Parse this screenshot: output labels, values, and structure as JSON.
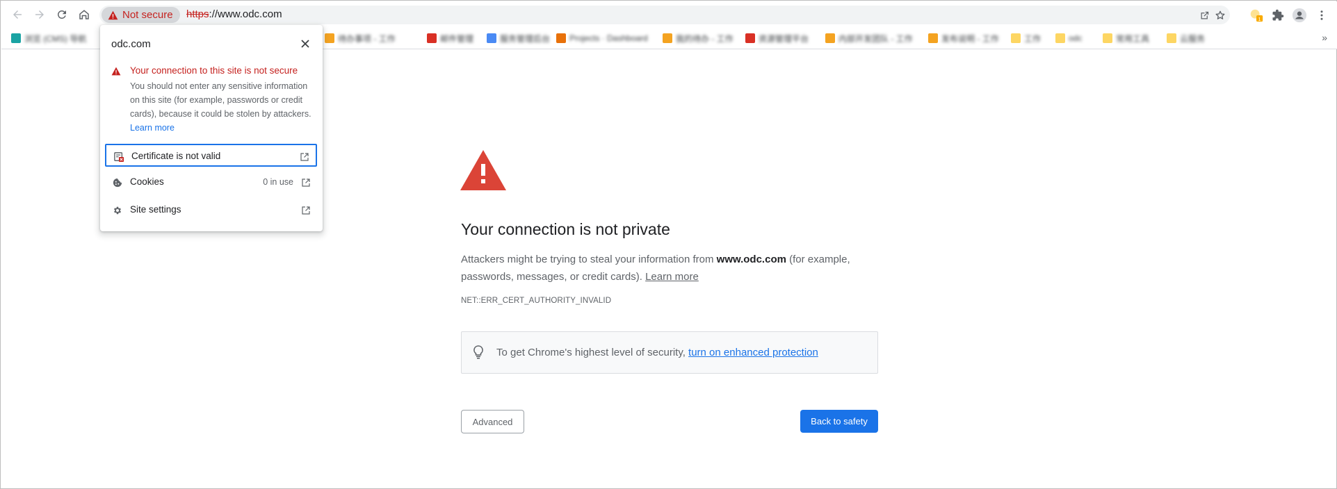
{
  "colors": {
    "accent": "#1a73e8",
    "danger": "#c5221f",
    "warning_red": "#db4437"
  },
  "toolbar": {
    "back_icon": "arrow-left-icon",
    "forward_icon": "arrow-right-icon",
    "reload_icon": "reload-icon",
    "home_icon": "home-icon",
    "security_chip": "Not secure",
    "url_scheme": "https",
    "url_rest": "://www.odc.com",
    "extension_badge": "1"
  },
  "bookmarks": [
    {
      "icon_color": "#1aa3a3",
      "label": "浏览 (CMS) 导航"
    },
    {
      "icon_color": "#f4a321",
      "label": "待办事项 - 工作"
    },
    {
      "icon_color": "#d93025",
      "label": "邮件管理"
    },
    {
      "icon_color": "#4a8af4",
      "label": "服务管理后台"
    },
    {
      "icon_color": "#e8710a",
      "label": "Projects · Dashboard"
    },
    {
      "icon_color": "#f4a321",
      "label": "我的待办 - 工作"
    },
    {
      "icon_color": "#d93025",
      "label": "资源管理平台"
    },
    {
      "icon_color": "#f4a321",
      "label": "内部开发团队 - 工作"
    },
    {
      "icon_color": "#f4a321",
      "label": "发布说明 - 工作"
    },
    {
      "icon_color": "#fdd663",
      "label": "工作"
    },
    {
      "icon_color": "#fdd663",
      "label": "odc"
    },
    {
      "icon_color": "#fdd663",
      "label": "常用工具"
    },
    {
      "icon_color": "#fdd663",
      "label": "云服务"
    }
  ],
  "popup": {
    "title": "odc.com",
    "warn_title": "Your connection to this site is not secure",
    "warn_desc": "You should not enter any sensitive information on this site (for example, passwords or credit cards), because it could be stolen by attackers.",
    "learn_more": "Learn more",
    "rows": [
      {
        "label": "Certificate is not valid",
        "value": "",
        "icon": "certificate-error-icon"
      },
      {
        "label": "Cookies",
        "value": "0 in use",
        "icon": "cookie-icon"
      },
      {
        "label": "Site settings",
        "value": "",
        "icon": "gear-icon"
      }
    ]
  },
  "interstitial": {
    "heading": "Your connection is not private",
    "para_before": "Attackers might be trying to steal your information from ",
    "para_domain": "www.odc.com",
    "para_after": " (for example, passwords, messages, or credit cards). ",
    "learn_more": "Learn more",
    "error_code": "NET::ERR_CERT_AUTHORITY_INVALID",
    "enhanced_text": "To get Chrome's highest level of security, ",
    "enhanced_link": "turn on enhanced protection",
    "advanced_button": "Advanced",
    "back_button": "Back to safety"
  }
}
